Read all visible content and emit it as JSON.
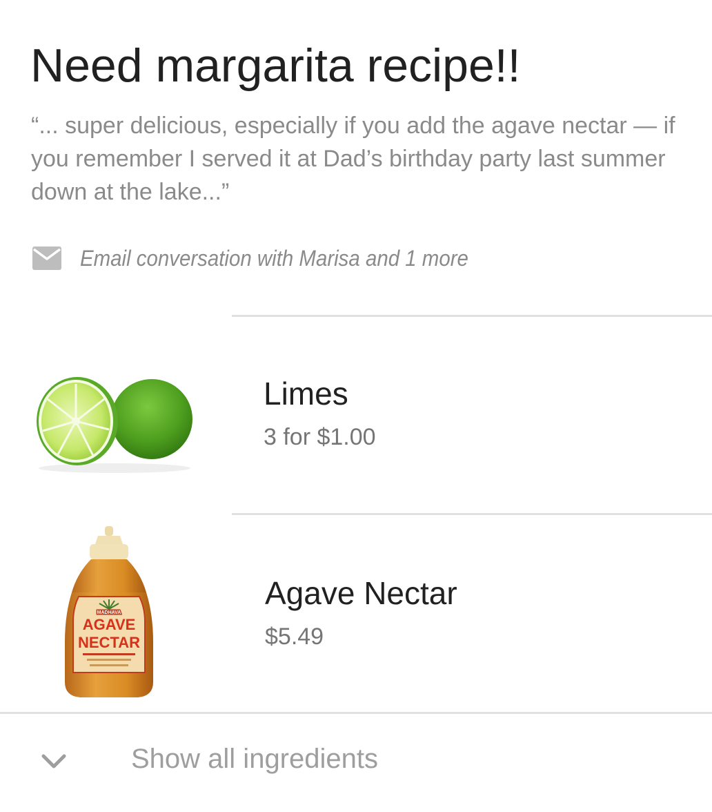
{
  "card": {
    "title": "Need margarita recipe!!",
    "snippet": "“... super delicious, especially if you add the agave nectar — if you remember I served it at Dad’s birthday party last summer down at the lake...”",
    "source": {
      "icon": "mail-icon",
      "text": "Email conversation with Marisa and 1 more"
    }
  },
  "items": [
    {
      "name": "Limes",
      "price": "3 for $1.00",
      "image": "limes-image"
    },
    {
      "name": "Agave Nectar",
      "price": "$5.49",
      "image": "agave-bottle-image"
    }
  ],
  "agave_label": {
    "line1": "AGAVE",
    "line2": "NECTAR",
    "brand": "MADHAVA"
  },
  "footer": {
    "label": "Show all ingredients",
    "icon": "chevron-down-icon"
  },
  "colors": {
    "title": "#212121",
    "secondary_text": "#8a8a8a",
    "divider": "#e0e0e0",
    "lime_green": "#5aa928",
    "agave_amber": "#d98c24"
  }
}
